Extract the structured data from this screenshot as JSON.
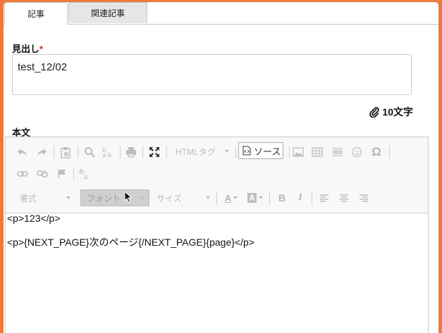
{
  "tabs": {
    "article": "記事",
    "related": "関連記事"
  },
  "headline": {
    "label": "見出し",
    "required_mark": "*",
    "value": "test_12/02"
  },
  "char_count": {
    "text": "10文字",
    "icon": "paperclip-icon"
  },
  "body": {
    "label": "本文"
  },
  "toolbar": {
    "html_tag_label": "HTMLタグ",
    "source_label": "ソース",
    "format_label": "書式",
    "font_label": "フォント",
    "size_label": "サイズ",
    "text_color_label": "A",
    "bg_color_label": "A",
    "bold_label": "B",
    "italic_label": "I"
  },
  "editor_content": {
    "line1": "<p>123</p>",
    "line2": "<p>{NEXT_PAGE}次のページ{/NEXT_PAGE}{page}</p>"
  },
  "colors": {
    "frame": "#ee7a3e",
    "required": "#dd2211",
    "toolbar_bg": "#f8f8f8"
  }
}
